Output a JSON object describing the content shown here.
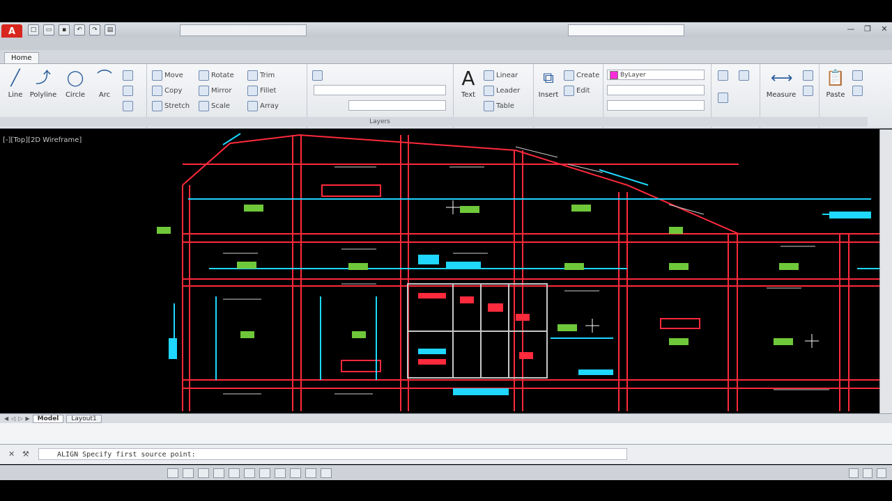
{
  "app": {
    "logo": "A",
    "qat_icons": [
      "new-icon",
      "open-icon",
      "save-icon",
      "undo-icon",
      "redo-icon",
      "print-icon"
    ],
    "window_controls": [
      "—",
      "❐",
      "✕"
    ]
  },
  "ribbon": {
    "active_tab": "Home",
    "panels": {
      "draw": {
        "line": "Line",
        "polyline": "Polyline",
        "circle": "Circle",
        "arc": "Arc"
      },
      "modify": {
        "move": "Move",
        "copy": "Copy",
        "stretch": "Stretch",
        "rotate": "Rotate",
        "mirror": "Mirror",
        "scale": "Scale",
        "trim": "Trim",
        "fillet": "Fillet",
        "array": "Array"
      },
      "layers": {
        "title": "Layers"
      },
      "annotation": {
        "text": "Text",
        "linear": "Linear",
        "leader": "Leader",
        "table": "Table"
      },
      "block": {
        "insert": "Insert",
        "create": "Create",
        "edit": "Edit"
      },
      "properties": {
        "color": "ByLayer"
      },
      "utilities": {
        "measure": "Measure"
      },
      "clipboard": {
        "paste": "Paste"
      }
    }
  },
  "viewport": {
    "label": "[-][Top][2D Wireframe]"
  },
  "layout_tabs": [
    "Model",
    "Layout1"
  ],
  "command": {
    "prompt": "ALIGN Specify first source point:"
  },
  "colors": {
    "magenta": "#ff2bd6",
    "cad_red": "#ff2a3c",
    "cad_cyan": "#1fd7ff",
    "cad_green": "#6fc83a"
  }
}
